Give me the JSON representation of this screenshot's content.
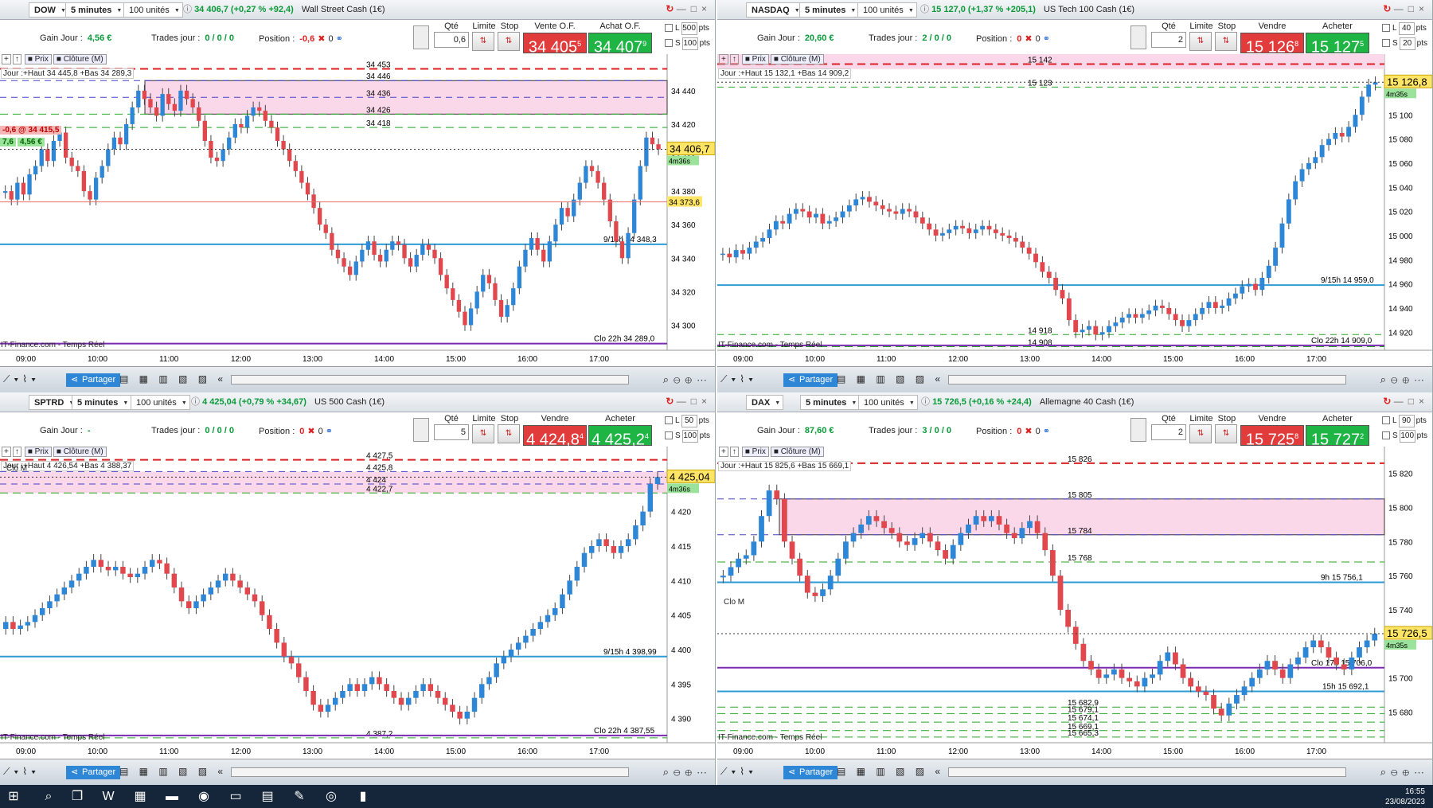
{
  "panels": [
    {
      "symbol": "DOW",
      "timeframe": "5 minutes",
      "units": "100 unités",
      "quote": "34 406,7 (+0,27 % +92,4)",
      "instrument": "Wall Street Cash (1€)",
      "gain_label": "Gain Jour :",
      "gain": "4,56 €",
      "trades_label": "Trades jour :",
      "trades": "0 / 0 / 0",
      "position_label": "Position :",
      "position": "-0,6",
      "position_extra": "0",
      "qty_label": "Qté",
      "qty": "0,6",
      "limit_label": "Limite",
      "stop_label": "Stop",
      "sell_label": "Vente O.F.",
      "sell_big": "34 405",
      "sell_small": "5",
      "buy_label": "Achat O.F.",
      "buy_big": "34 407",
      "buy_small": "9",
      "L_pts": "500",
      "S_pts": "100",
      "day_info": "Jour :+Haut 34 445,8 +Bas 34 289,3",
      "pos_tag": "-0,6 @ 34 415,5",
      "pnl_tag": "4,56 €",
      "pnl_qty": "7,6",
      "price_tag": "34 406,7",
      "timer": "4m36s",
      "avg_tag": "34 373,6",
      "yaxis": {
        "min": 34285,
        "max": 34458,
        "ticks": [
          34300,
          34320,
          34340,
          34360,
          34380,
          34400,
          34420,
          34440
        ],
        "labels": [
          "34 300",
          "34 320",
          "34 340",
          "34 360",
          "34 380",
          "34 400",
          "34 420",
          "34 440"
        ]
      },
      "xlabels": [
        "09:00",
        "10:00",
        "11:00",
        "12:00",
        "13:00",
        "14:00",
        "15:00",
        "16:00",
        "17:00"
      ],
      "levels": [
        {
          "v": 34453,
          "t": "34 453"
        },
        {
          "v": 34446,
          "t": "34 446"
        },
        {
          "v": 34436,
          "t": "34 436"
        },
        {
          "v": 34426,
          "t": "34 426"
        },
        {
          "v": 34418,
          "t": "34 418"
        }
      ],
      "note1": "9/15h 34 348,3",
      "note1v": 34348.3,
      "note2": "Clo 22h 34 289,0",
      "note2v": 34289,
      "footer": "IT-Finance.com - Temps Réel",
      "share": "Partager",
      "chart_data": {
        "type": "candlestick",
        "close": [
          34380,
          34375,
          34385,
          34378,
          34390,
          34395,
          34405,
          34398,
          34410,
          34415,
          34400,
          34395,
          34392,
          34380,
          34375,
          34388,
          34395,
          34405,
          34412,
          34408,
          34420,
          34430,
          34440,
          34435,
          34430,
          34425,
          34438,
          34432,
          34428,
          34440,
          34435,
          34430,
          34422,
          34410,
          34400,
          34398,
          34405,
          34412,
          34420,
          34418,
          34425,
          34430,
          34428,
          34422,
          34418,
          34410,
          34405,
          34398,
          34392,
          34385,
          34378,
          34370,
          34360,
          34355,
          34345,
          34340,
          34335,
          34330,
          34338,
          34345,
          34350,
          34342,
          34338,
          34345,
          34350,
          34348,
          34340,
          34335,
          34342,
          34348,
          34345,
          34340,
          34330,
          34322,
          34315,
          34308,
          34300,
          34310,
          34320,
          34330,
          34325,
          34315,
          34305,
          34312,
          34322,
          34335,
          34345,
          34352,
          34345,
          34338,
          34350,
          34360,
          34370,
          34365,
          34375,
          34385,
          34395,
          34392,
          34385,
          34375,
          34362,
          34350,
          34340,
          34355,
          34375,
          34395,
          34412,
          34408,
          34405
        ]
      }
    },
    {
      "symbol": "NASDAQ",
      "timeframe": "5 minutes",
      "units": "100 unités",
      "quote": "15 127,0 (+1,37 % +205,1)",
      "instrument": "US Tech 100 Cash (1€)",
      "gain_label": "Gain Jour :",
      "gain": "20,60 €",
      "trades_label": "Trades jour :",
      "trades": "2 / 0 / 0",
      "position_label": "Position :",
      "position": "0",
      "position_extra": "0",
      "qty_label": "Qté",
      "qty": "2",
      "limit_label": "Limite",
      "stop_label": "Stop",
      "sell_label": "Vendre",
      "sell_big": "15 126",
      "sell_small": "8",
      "buy_label": "Acheter",
      "buy_big": "15 127",
      "buy_small": "5",
      "L_pts": "40",
      "S_pts": "20",
      "day_info": "Jour :+Haut 15 132,1 +Bas 14 909,2",
      "price_tag": "15 126,8",
      "timer": "4m35s",
      "yaxis": {
        "min": 14905,
        "max": 15145,
        "ticks": [
          14920,
          14940,
          14960,
          14980,
          15000,
          15020,
          15040,
          15060,
          15080,
          15100
        ],
        "labels": [
          "14 920",
          "14 940",
          "14 960",
          "14 980",
          "15 000",
          "15 020",
          "15 040",
          "15 060",
          "15 080",
          "15 100"
        ]
      },
      "xlabels": [
        "09:00",
        "10:00",
        "11:00",
        "12:00",
        "13:00",
        "14:00",
        "15:00",
        "16:00",
        "17:00"
      ],
      "levels": [
        {
          "v": 15142,
          "t": "15 142"
        },
        {
          "v": 15123,
          "t": "15 123"
        },
        {
          "v": 14918,
          "t": "14 918"
        },
        {
          "v": 14908,
          "t": "14 908"
        }
      ],
      "note1": "9/15h 14 959,0",
      "note1v": 14959,
      "note2": "Clo 22h 14 909,0",
      "note2v": 14909,
      "footer": "IT-Finance.com - Temps Réel",
      "share": "Partager",
      "chart_data": {
        "type": "candlestick",
        "close": [
          14985,
          14982,
          14988,
          14985,
          14990,
          14995,
          14998,
          15005,
          15012,
          15010,
          15018,
          15022,
          15020,
          15015,
          15018,
          15010,
          15012,
          15015,
          15020,
          15025,
          15030,
          15032,
          15028,
          15025,
          15022,
          15020,
          15018,
          15022,
          15020,
          15015,
          15010,
          15005,
          15000,
          15002,
          15005,
          15008,
          15006,
          15002,
          15005,
          15008,
          15005,
          15002,
          15000,
          14998,
          14995,
          14990,
          14985,
          14978,
          14970,
          14965,
          14955,
          14948,
          14930,
          14920,
          14922,
          14925,
          14918,
          14920,
          14925,
          14928,
          14932,
          14935,
          14932,
          14935,
          14938,
          14942,
          14940,
          14935,
          14930,
          14925,
          14930,
          14935,
          14940,
          14945,
          14940,
          14942,
          14948,
          14952,
          14958,
          14960,
          14955,
          14965,
          14975,
          14990,
          15010,
          15030,
          15045,
          15055,
          15060,
          15065,
          15075,
          15080,
          15085,
          15082,
          15090,
          15100,
          15115,
          15125,
          15127
        ]
      }
    },
    {
      "symbol": "SPTRD",
      "timeframe": "5 minutes",
      "units": "100 unités",
      "quote": "4 425,04 (+0,79 % +34,67)",
      "instrument": "US 500 Cash (1€)",
      "gain_label": "Gain Jour :",
      "gain": "-",
      "trades_label": "Trades jour :",
      "trades": "0 / 0 / 0",
      "position_label": "Position :",
      "position": "0",
      "position_extra": "0",
      "qty_label": "Qté",
      "qty": "5",
      "limit_label": "Limite",
      "stop_label": "Stop",
      "sell_label": "Vendre",
      "sell_big": "4 424,8",
      "sell_small": "4",
      "buy_label": "Acheter",
      "buy_big": "4 425,2",
      "buy_small": "4",
      "L_pts": "50",
      "S_pts": "100",
      "day_info": "Jour :+Haut 4 426,54 +Bas 4 388,37",
      "price_tag": "4 425,04",
      "timer": "4m36s",
      "clo": "Clo M",
      "yaxis": {
        "min": 4386.5,
        "max": 4428.5,
        "ticks": [
          4390,
          4395,
          4400,
          4405,
          4410,
          4415,
          4420
        ],
        "labels": [
          "4 390",
          "4 395",
          "4 400",
          "4 405",
          "4 410",
          "4 415",
          "4 420"
        ]
      },
      "xlabels": [
        "09:00",
        "10:00",
        "11:00",
        "12:00",
        "13:00",
        "14:00",
        "15:00",
        "16:00",
        "17:00"
      ],
      "levels": [
        {
          "v": 4427.5,
          "t": "4 427,5"
        },
        {
          "v": 4425.8,
          "t": "4 425,8"
        },
        {
          "v": 4424,
          "t": "4 424"
        },
        {
          "v": 4422.7,
          "t": "4 422,7"
        },
        {
          "v": 4387.2,
          "t": "4 387,2"
        }
      ],
      "note1": "9/15h 4 398,99",
      "note1v": 4398.99,
      "note2": "Clo 22h 4 387,55",
      "note2v": 4387.55,
      "footer": "IT-Finance.com - Temps Réel",
      "share": "Partager",
      "chart_data": {
        "type": "candlestick",
        "close": [
          4404,
          4403,
          4403.5,
          4404,
          4405,
          4406,
          4407,
          4408,
          4409,
          4410,
          4411,
          4412,
          4413,
          4412,
          4411.5,
          4412,
          4411,
          4410.5,
          4411,
          4412,
          4413,
          4412.5,
          4411,
          4409,
          4407,
          4406,
          4407,
          4408,
          4409,
          4410,
          4411,
          4410,
          4409,
          4408,
          4407,
          4405,
          4403,
          4401,
          4399,
          4398,
          4396,
          4394,
          4392,
          4391,
          4392,
          4393,
          4394,
          4395,
          4394,
          4395,
          4396,
          4395,
          4394,
          4393,
          4392,
          4393,
          4394,
          4395,
          4394,
          4393,
          4392,
          4391,
          4390,
          4391,
          4393,
          4395,
          4396,
          4398,
          4399,
          4400,
          4401,
          4402,
          4403,
          4404,
          4405,
          4406,
          4408,
          4410,
          4412,
          4414,
          4415,
          4416,
          4415,
          4414,
          4415,
          4416,
          4418,
          4420,
          4424,
          4425
        ]
      }
    },
    {
      "symbol": "DAX",
      "timeframe": "5 minutes",
      "units": "100 unités",
      "quote": "15 726,5 (+0,16 % +24,4)",
      "instrument": "Allemagne 40 Cash (1€)",
      "gain_label": "Gain Jour :",
      "gain": "87,60 €",
      "trades_label": "Trades jour :",
      "trades": "3 / 0 / 0",
      "position_label": "Position :",
      "position": "0",
      "position_extra": "0",
      "qty_label": "Qté",
      "qty": "2",
      "limit_label": "Limite",
      "stop_label": "Stop",
      "sell_label": "Vendre",
      "sell_big": "15 725",
      "sell_small": "8",
      "buy_label": "Acheter",
      "buy_big": "15 727",
      "buy_small": "2",
      "L_pts": "90",
      "S_pts": "100",
      "day_info": "Jour :+Haut 15 825,6 +Bas 15 669,1",
      "price_tag": "15 726,5",
      "timer": "4m35s",
      "clo": "Clo M",
      "yaxis": {
        "min": 15662,
        "max": 15832,
        "ticks": [
          15680,
          15700,
          15720,
          15740,
          15760,
          15780,
          15800,
          15820
        ],
        "labels": [
          "15 680",
          "15 700",
          "15 720",
          "15 740",
          "15 760",
          "15 780",
          "15 800",
          "15 820"
        ]
      },
      "xlabels": [
        "09:00",
        "10:00",
        "11:00",
        "12:00",
        "13:00",
        "14:00",
        "15:00",
        "16:00",
        "17:00"
      ],
      "levels": [
        {
          "v": 15826,
          "t": "15 826"
        },
        {
          "v": 15805,
          "t": "15 805"
        },
        {
          "v": 15784,
          "t": "15 784"
        },
        {
          "v": 15768,
          "t": "15 768"
        },
        {
          "v": 15682.9,
          "t": "15 682,9"
        },
        {
          "v": 15679.1,
          "t": "15 679,1"
        },
        {
          "v": 15674.1,
          "t": "15 674,1"
        },
        {
          "v": 15669.1,
          "t": "15 669,1"
        },
        {
          "v": 15665.3,
          "t": "15 665,3"
        }
      ],
      "note1": "9h 15 756,1",
      "note1v": 15756.1,
      "note2": "Clo 17h 15 706,0",
      "note2v": 15706,
      "note3": "15h 15 692,1",
      "note3v": 15692.1,
      "footer": "IT-Finance.com - Temps Réel",
      "share": "Partager",
      "chart_data": {
        "type": "candlestick",
        "close": [
          15760,
          15765,
          15770,
          15772,
          15780,
          15795,
          15810,
          15805,
          15780,
          15770,
          15760,
          15750,
          15748,
          15752,
          15760,
          15770,
          15780,
          15785,
          15790,
          15795,
          15792,
          15788,
          15785,
          15780,
          15778,
          15782,
          15785,
          15780,
          15775,
          15770,
          15778,
          15785,
          15790,
          15795,
          15792,
          15795,
          15790,
          15785,
          15782,
          15788,
          15792,
          15785,
          15775,
          15760,
          15740,
          15730,
          15720,
          15710,
          15705,
          15700,
          15702,
          15705,
          15700,
          15698,
          15695,
          15700,
          15702,
          15710,
          15715,
          15708,
          15700,
          15695,
          15692,
          15690,
          15682,
          15678,
          15685,
          15690,
          15695,
          15700,
          15705,
          15710,
          15705,
          15700,
          15708,
          15712,
          15718,
          15722,
          15718,
          15712,
          15708,
          15705,
          15712,
          15718,
          15722,
          15726
        ]
      }
    }
  ],
  "taskbar": {
    "time": "16:55",
    "date": "23/08/2023"
  }
}
